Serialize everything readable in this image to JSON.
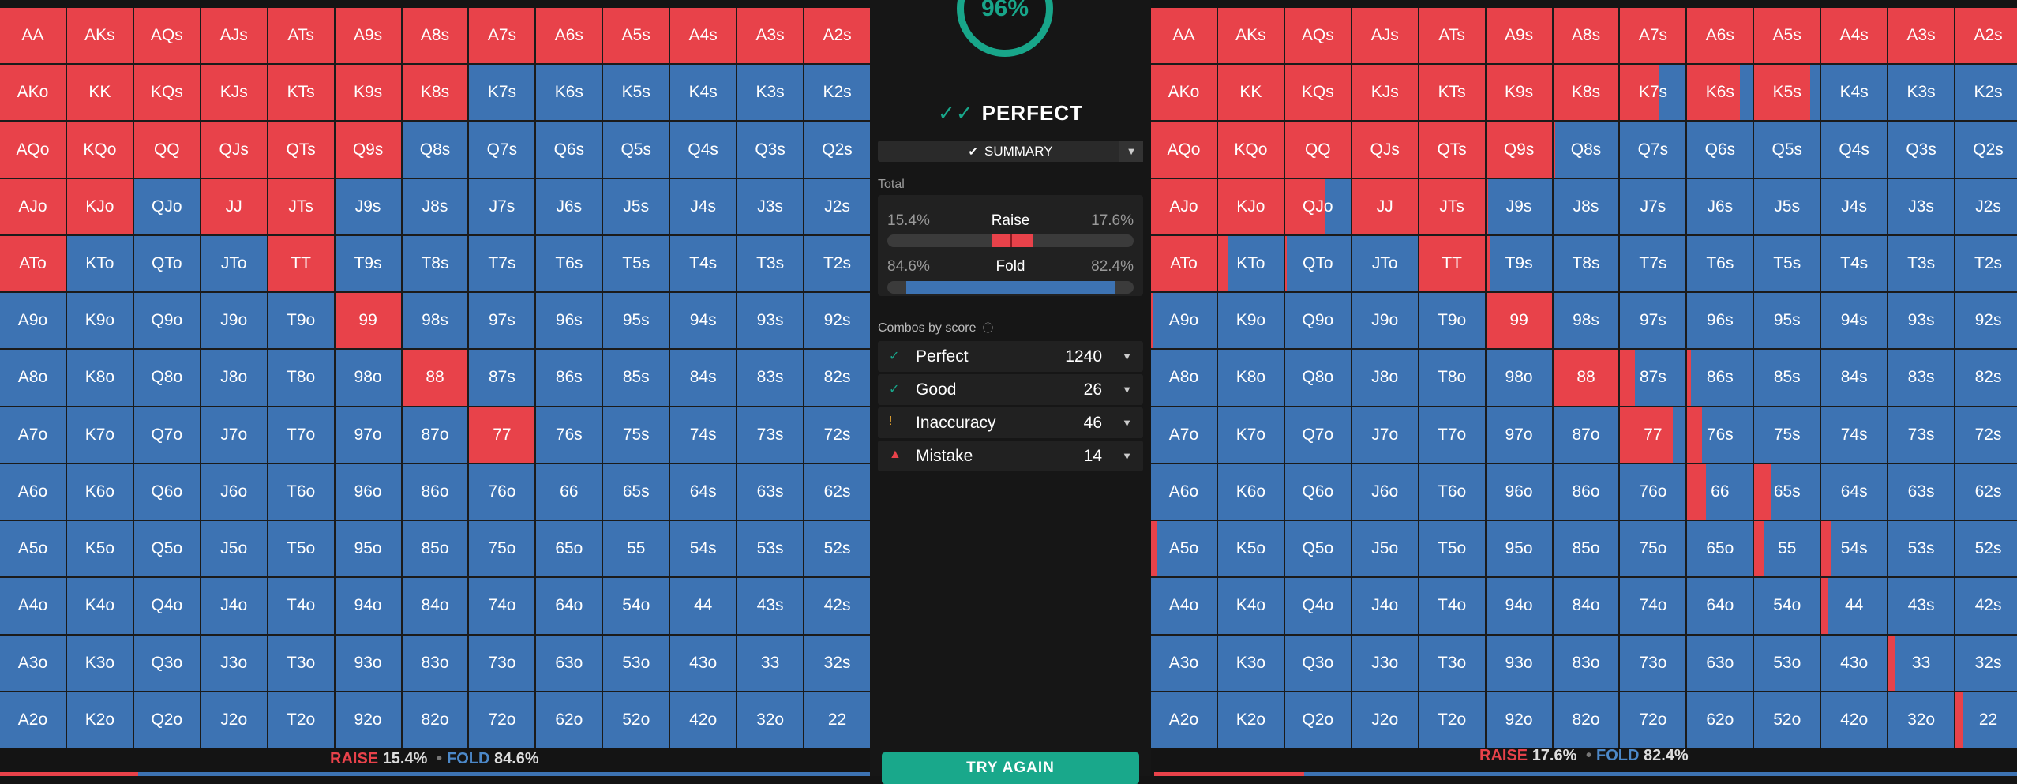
{
  "hands": [
    "AA",
    "AKs",
    "AQs",
    "AJs",
    "ATs",
    "A9s",
    "A8s",
    "A7s",
    "A6s",
    "A5s",
    "A4s",
    "A3s",
    "A2s",
    "AKo",
    "KK",
    "KQs",
    "KJs",
    "KTs",
    "K9s",
    "K8s",
    "K7s",
    "K6s",
    "K5s",
    "K4s",
    "K3s",
    "K2s",
    "AQo",
    "KQo",
    "QQ",
    "QJs",
    "QTs",
    "Q9s",
    "Q8s",
    "Q7s",
    "Q6s",
    "Q5s",
    "Q4s",
    "Q3s",
    "Q2s",
    "AJo",
    "KJo",
    "QJo",
    "JJ",
    "JTs",
    "J9s",
    "J8s",
    "J7s",
    "J6s",
    "J5s",
    "J4s",
    "J3s",
    "J2s",
    "ATo",
    "KTo",
    "QTo",
    "JTo",
    "TT",
    "T9s",
    "T8s",
    "T7s",
    "T6s",
    "T5s",
    "T4s",
    "T3s",
    "T2s",
    "A9o",
    "K9o",
    "Q9o",
    "J9o",
    "T9o",
    "99",
    "98s",
    "97s",
    "96s",
    "95s",
    "94s",
    "93s",
    "92s",
    "A8o",
    "K8o",
    "Q8o",
    "J8o",
    "T8o",
    "98o",
    "88",
    "87s",
    "86s",
    "85s",
    "84s",
    "83s",
    "82s",
    "A7o",
    "K7o",
    "Q7o",
    "J7o",
    "T7o",
    "97o",
    "87o",
    "77",
    "76s",
    "75s",
    "74s",
    "73s",
    "72s",
    "A6o",
    "K6o",
    "Q6o",
    "J6o",
    "T6o",
    "96o",
    "86o",
    "76o",
    "66",
    "65s",
    "64s",
    "63s",
    "62s",
    "A5o",
    "K5o",
    "Q5o",
    "J5o",
    "T5o",
    "95o",
    "85o",
    "75o",
    "65o",
    "55",
    "54s",
    "53s",
    "52s",
    "A4o",
    "K4o",
    "Q4o",
    "J4o",
    "T4o",
    "94o",
    "84o",
    "74o",
    "64o",
    "54o",
    "44",
    "43s",
    "42s",
    "A3o",
    "K3o",
    "Q3o",
    "J3o",
    "T3o",
    "93o",
    "83o",
    "73o",
    "63o",
    "53o",
    "43o",
    "33",
    "32s",
    "A2o",
    "K2o",
    "Q2o",
    "J2o",
    "T2o",
    "92o",
    "82o",
    "72o",
    "62o",
    "52o",
    "42o",
    "32o",
    "22"
  ],
  "colors": {
    "raise": "#e8424a",
    "fold": "#3d73b3",
    "accent": "#18a68a"
  },
  "left_chart": {
    "raise_frac": [
      1,
      1,
      1,
      1,
      1,
      1,
      1,
      1,
      1,
      1,
      1,
      1,
      1,
      1,
      1,
      1,
      1,
      1,
      1,
      1,
      0,
      0,
      0,
      0,
      0,
      0,
      1,
      1,
      1,
      1,
      1,
      1,
      0,
      0,
      0,
      0,
      0,
      0,
      0,
      1,
      1,
      0,
      1,
      1,
      0,
      0,
      0,
      0,
      0,
      0,
      0,
      0,
      1,
      0,
      0,
      0,
      1,
      0,
      0,
      0,
      0,
      0,
      0,
      0,
      0,
      0,
      0,
      0,
      0,
      0,
      1,
      0,
      0,
      0,
      0,
      0,
      0,
      0,
      0,
      0,
      0,
      0,
      0,
      0,
      1,
      0,
      0,
      0,
      0,
      0,
      0,
      0,
      0,
      0,
      0,
      0,
      0,
      0,
      1,
      0,
      0,
      0,
      0,
      0,
      0,
      0,
      0,
      0,
      0,
      0,
      0,
      0,
      0,
      0,
      0,
      0,
      0,
      0,
      0,
      0,
      0,
      0,
      0,
      0,
      0,
      0,
      0,
      0,
      0,
      0,
      0,
      0,
      0,
      0,
      0,
      0,
      0,
      0,
      0,
      0,
      0,
      0,
      0,
      0,
      0,
      0,
      0,
      0,
      0,
      0,
      0,
      0,
      0,
      0,
      0,
      0,
      0,
      0,
      0,
      0,
      0,
      0,
      0,
      0,
      0,
      0,
      0,
      0,
      0
    ],
    "footer": {
      "raise_label": "RAISE",
      "raise_pct": "15.4%",
      "fold_label": "FOLD",
      "fold_pct": "84.6%"
    }
  },
  "right_chart": {
    "raise_frac": [
      1,
      1,
      1,
      1,
      1,
      1,
      1,
      1,
      1,
      1,
      1,
      1,
      1,
      1,
      1,
      1,
      1,
      1,
      1,
      1,
      0.6,
      0.8,
      0.85,
      0,
      0,
      0,
      1,
      1,
      1,
      1,
      1,
      1,
      0.03,
      0,
      0,
      0,
      0,
      0,
      0,
      1,
      1,
      0.6,
      1,
      1,
      0.03,
      0,
      0,
      0,
      0,
      0,
      0,
      0,
      1,
      0.15,
      0.03,
      0,
      1,
      0.05,
      0.02,
      0,
      0,
      0,
      0,
      0,
      0,
      0.02,
      0,
      0,
      0,
      0,
      1,
      0.02,
      0,
      0,
      0,
      0,
      0,
      0,
      0,
      0,
      0,
      0,
      0,
      0,
      1,
      0.22,
      0.05,
      0,
      0,
      0,
      0,
      0,
      0,
      0,
      0,
      0,
      0,
      0,
      0.8,
      0.22,
      0,
      0,
      0,
      0,
      0,
      0,
      0,
      0,
      0,
      0,
      0,
      0,
      0.28,
      0.25,
      0,
      0,
      0,
      0.08,
      0,
      0,
      0,
      0,
      0,
      0,
      0,
      0,
      0.15,
      0.15,
      0,
      0,
      0,
      0,
      0,
      0,
      0,
      0,
      0,
      0,
      0,
      0,
      0.1,
      0,
      0,
      0,
      0,
      0,
      0,
      0,
      0,
      0,
      0,
      0,
      0,
      0,
      0.09,
      0,
      0,
      0,
      0,
      0,
      0,
      0,
      0,
      0,
      0,
      0,
      0,
      0,
      0.12
    ],
    "footer": {
      "raise_label": "RAISE",
      "raise_pct": "17.6%",
      "fold_label": "FOLD",
      "fold_pct": "82.4%"
    }
  },
  "panel": {
    "score": "96%",
    "verdict": "PERFECT",
    "summary_label": "SUMMARY",
    "total_label": "Total",
    "raise": {
      "left": "15.4%",
      "label": "Raise",
      "right": "17.6%",
      "left_frac": 0.154,
      "right_frac": 0.176
    },
    "fold": {
      "left": "84.6%",
      "label": "Fold",
      "right": "82.4%",
      "left_frac": 0.846,
      "right_frac": 0.824
    },
    "combos_label": "Combos by score",
    "combos": [
      {
        "icon": "✓",
        "name": "Perfect",
        "value": "1240",
        "color": "#18a68a"
      },
      {
        "icon": "✓",
        "name": "Good",
        "value": "26",
        "color": "#18a68a"
      },
      {
        "icon": "!",
        "name": "Inaccuracy",
        "value": "46",
        "color": "#e0a030"
      },
      {
        "icon": "▲",
        "name": "Mistake",
        "value": "14",
        "color": "#e8424a"
      }
    ],
    "try_again": "TRY AGAIN"
  }
}
